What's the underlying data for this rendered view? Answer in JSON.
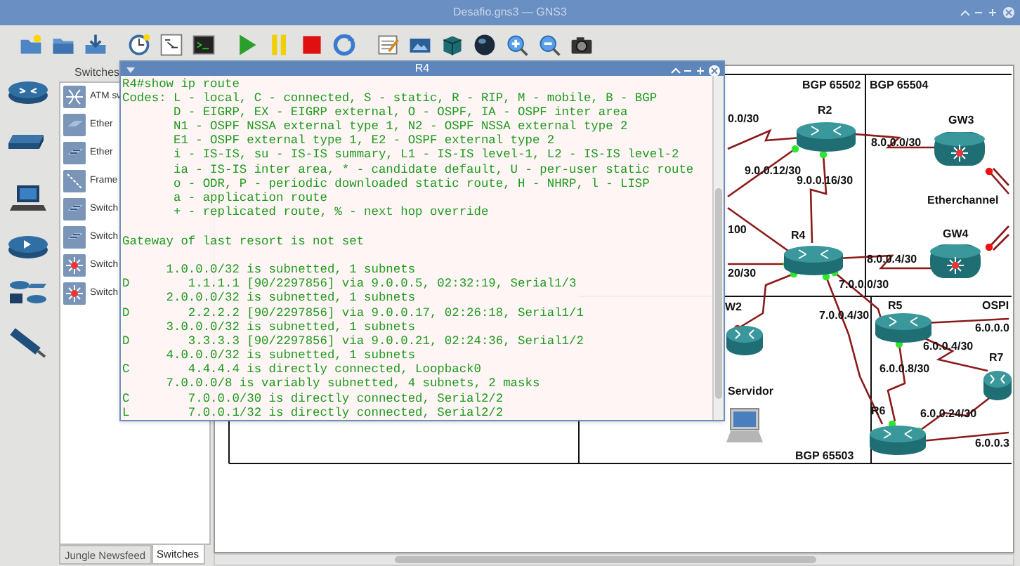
{
  "window": {
    "title": "Desafio.gns3 — GNS3"
  },
  "dock": {
    "title": "Switches",
    "items": [
      {
        "label": "ATM sw",
        "kind": "atm"
      },
      {
        "label": "Ether",
        "kind": "hub"
      },
      {
        "label": "Ether",
        "kind": "switch"
      },
      {
        "label": "Frame",
        "kind": "frame"
      },
      {
        "label": "Switch",
        "kind": "switch"
      },
      {
        "label": "Switch",
        "kind": "switch"
      },
      {
        "label": "Switch",
        "kind": "multilayer"
      },
      {
        "label": "Switch",
        "kind": "multilayer"
      }
    ],
    "tabs": [
      {
        "label": "Jungle Newsfeed",
        "selected": false
      },
      {
        "label": "Switches",
        "selected": true
      }
    ]
  },
  "console": {
    "title": "R4",
    "blocks": [
      [
        "R4#show ip route",
        "Codes: L - local, C - connected, S - static, R - RIP, M - mobile, B - BGP",
        "       D - EIGRP, EX - EIGRP external, O - OSPF, IA - OSPF inter area",
        "       N1 - OSPF NSSA external type 1, N2 - OSPF NSSA external type 2",
        "       E1 - OSPF external type 1, E2 - OSPF external type 2",
        "       i - IS-IS, su - IS-IS summary, L1 - IS-IS level-1, L2 - IS-IS level-2",
        "       ia - IS-IS inter area, * - candidate default, U - per-user static route",
        "       o - ODR, P - periodic downloaded static route, H - NHRP, l - LISP",
        "       a - application route",
        "       + - replicated route, % - next hop override"
      ],
      [
        "Gateway of last resort is not set"
      ],
      [
        "      1.0.0.0/32 is subnetted, 1 subnets",
        "D        1.1.1.1 [90/2297856] via 9.0.0.5, 02:32:19, Serial1/3",
        "      2.0.0.0/32 is subnetted, 1 subnets",
        "D        2.2.2.2 [90/2297856] via 9.0.0.17, 02:26:18, Serial1/1",
        "      3.0.0.0/32 is subnetted, 1 subnets",
        "D        3.3.3.3 [90/2297856] via 9.0.0.21, 02:24:36, Serial1/2",
        "      4.0.0.0/32 is subnetted, 1 subnets",
        "C        4.4.4.4 is directly connected, Loopback0",
        "      7.0.0.0/8 is variably subnetted, 4 subnets, 2 masks",
        "C        7.0.0.0/30 is directly connected, Serial2/2",
        "L        7.0.0.1/32 is directly connected, Serial2/2"
      ]
    ]
  },
  "topology": {
    "zones": [
      "BGP 65502",
      "BGP 65504",
      "BGP 65503",
      "OSPI"
    ],
    "nodes": [
      {
        "label": "R2",
        "kind": "router"
      },
      {
        "label": "GW3",
        "kind": "multilayer"
      },
      {
        "label": "R4",
        "kind": "router"
      },
      {
        "label": "GW4",
        "kind": "multilayer"
      },
      {
        "label": "W2",
        "kind": "router"
      },
      {
        "label": "Servidor",
        "kind": "pc"
      },
      {
        "label": "R5",
        "kind": "router"
      },
      {
        "label": "R6",
        "kind": "router"
      },
      {
        "label": "R7",
        "kind": "router"
      }
    ],
    "labels": [
      "0.0/30",
      "9.0.0.12/30",
      "9.0.0.16/30",
      "8.0.0.0/30",
      "Etherchannel",
      "100",
      "20/30",
      "8.0.0.4/30",
      "7.0.0.0/30",
      "7.0.0.4/30",
      "6.0.0.0",
      "6.0.0.4/30",
      "6.0.0.8/30",
      "6.0.0.24/30",
      "6.0.0.3"
    ]
  }
}
